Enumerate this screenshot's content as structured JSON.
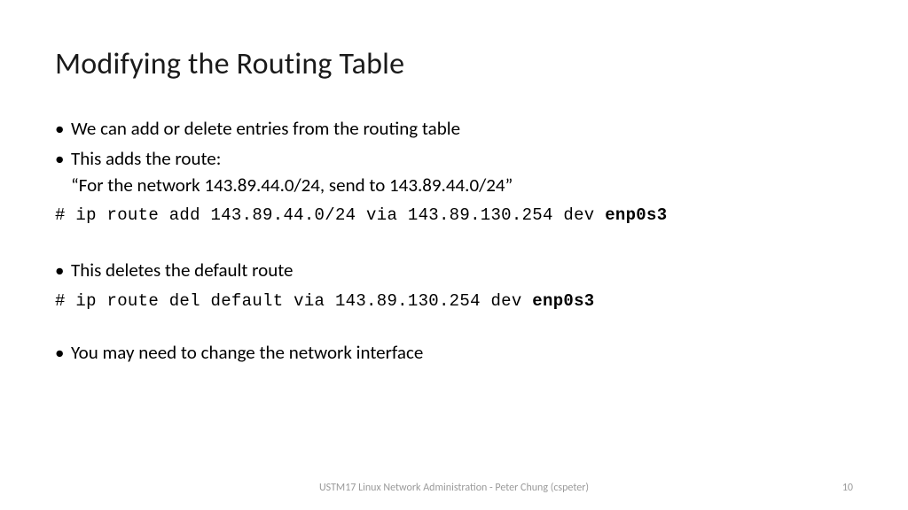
{
  "title": "Modifying the Routing Table",
  "bullets": {
    "b1": "We can add or delete entries from the routing table",
    "b2a": "This adds the route:",
    "b2b": "“For the network 143.89.44.0/24, send to 143.89.44.0/24”",
    "b3": "This deletes the default route",
    "b4": "You may need to change the network interface"
  },
  "code": {
    "c1_pre": "# ip route add 143.89.44.0/24 via 143.89.130.254 dev ",
    "c1_bold": "enp0s3",
    "c2_pre": "# ip route del default via 143.89.130.254 dev ",
    "c2_bold": "enp0s3"
  },
  "footer": {
    "text": "USTM17 Linux Network Administration - Peter Chung (cspeter)",
    "page": "10"
  },
  "glyph": {
    "bullet": "•"
  }
}
